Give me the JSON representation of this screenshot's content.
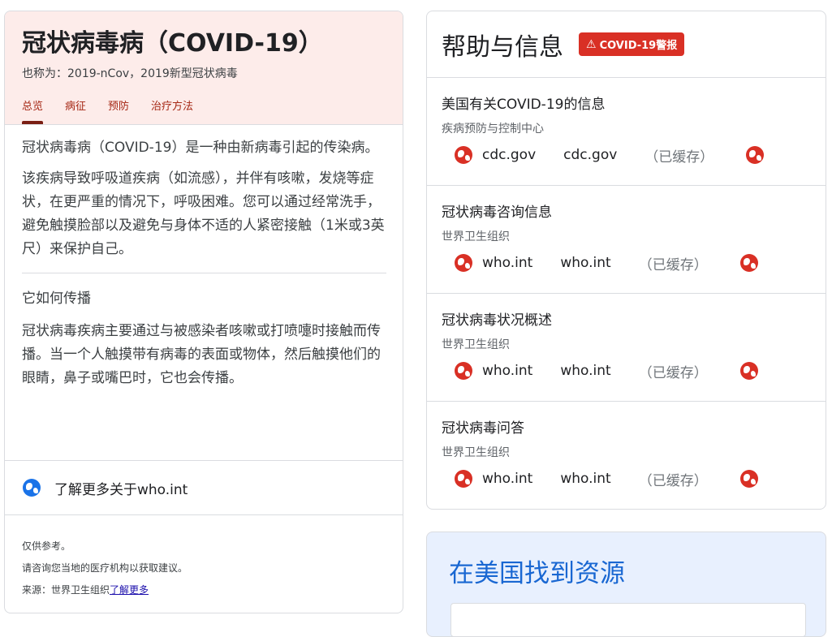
{
  "overview": {
    "title": "冠状病毒病（COVID-19）",
    "also_known_as": "也称为：2019-nCov，2019新型冠状病毒",
    "tabs": [
      {
        "label": "总览",
        "active": true
      },
      {
        "label": "病征",
        "active": false
      },
      {
        "label": "预防",
        "active": false
      },
      {
        "label": "治疗方法",
        "active": false
      }
    ],
    "paragraph1": "冠状病毒病（COVID-19）是一种由新病毒引起的传染病。",
    "paragraph2": "该疾病导致呼吸道疾病（如流感），并伴有咳嗽，发烧等症状，在更严重的情况下，呼吸困难。您可以通过经常洗手，避免触摸脸部以及避免与身体不适的人紧密接触（1米或3英尺）来保护自己。",
    "section_heading": "它如何传播",
    "paragraph3": "冠状病毒疾病主要通过与被感染者咳嗽或打喷嚏时接触而传播。当一个人触摸带有病毒的表面或物体，然后触摸他们的眼睛，鼻子或嘴巴时，它也会传播。",
    "learn_more": "了解更多关于who.int",
    "footer_line1": "仅供参考。",
    "footer_line2": "请咨询您当地的医疗机构以获取建议。",
    "footer_source_prefix": "来源：世界卫生组织",
    "footer_source_link": "了解更多"
  },
  "help": {
    "title": "帮助与信息",
    "alert_label": "COVID-19警报",
    "resources": [
      {
        "title": "美国有关COVID-19的信息",
        "source": "疾病预防与控制中心",
        "link1": "cdc.gov",
        "link2": "cdc.gov",
        "cached": "（已缓存）"
      },
      {
        "title": "冠状病毒咨询信息",
        "source": "世界卫生组织",
        "link1": "who.int",
        "link2": "who.int",
        "cached": "（已缓存）"
      },
      {
        "title": "冠状病毒状况概述",
        "source": "世界卫生组织",
        "link1": "who.int",
        "link2": "who.int",
        "cached": "（已缓存）"
      },
      {
        "title": "冠状病毒问答",
        "source": "世界卫生组织",
        "link1": "who.int",
        "link2": "who.int",
        "cached": "（已缓存）"
      }
    ]
  },
  "find_resources": {
    "title": "在美国找到资源"
  },
  "colors": {
    "accent_red": "#d93025",
    "header_pink": "#fdecea",
    "link_blue": "#1a73e8",
    "find_blue": "#1967d2"
  },
  "icons": {
    "globe": "globe-icon",
    "warning": "warning-triangle-icon"
  }
}
